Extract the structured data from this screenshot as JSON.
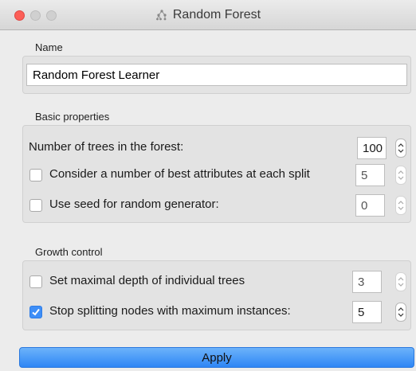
{
  "window": {
    "title": "Random Forest",
    "title_icon": "random-forest-icon"
  },
  "name_section": {
    "label": "Name",
    "value": "Random Forest Learner"
  },
  "basic": {
    "label": "Basic properties",
    "trees_label": "Number of trees in the forest:",
    "trees_value": "100",
    "best_attr_label": "Consider a number of best attributes at each split",
    "best_attr_checked": false,
    "best_attr_value": "5",
    "seed_label": "Use seed for random generator:",
    "seed_checked": false,
    "seed_value": "0"
  },
  "growth": {
    "label": "Growth control",
    "depth_label": "Set maximal depth of individual trees",
    "depth_checked": false,
    "depth_value": "3",
    "split_label": "Stop splitting nodes with maximum instances:",
    "split_checked": true,
    "split_value": "5"
  },
  "apply_label": "Apply",
  "colors": {
    "accent": "#3e8ef7",
    "close": "#fc5f57"
  }
}
